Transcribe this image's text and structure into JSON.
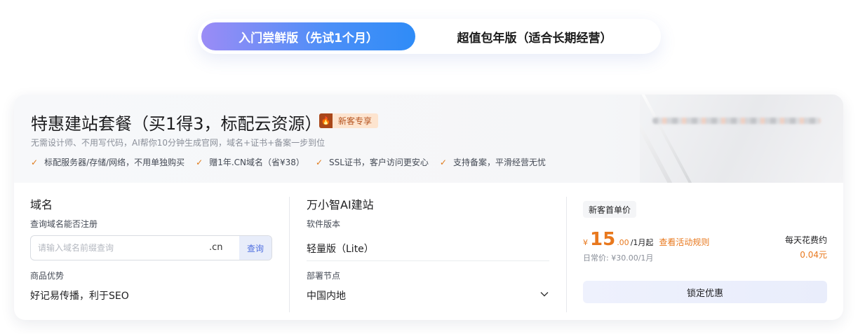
{
  "tabs": [
    {
      "label": "入门尝鲜版（先试1个月）",
      "active": true
    },
    {
      "label": "超值包年版（适合长期经营）",
      "active": false
    }
  ],
  "package": {
    "title": "特惠建站套餐（买1得3，标配云资源）",
    "badge_icon": "flame-icon",
    "badge": "新客专享",
    "subtitle": "无需设计师、不用写代码，AI帮你10分钟生成官网，域名+证书+备案一步到位",
    "features": [
      "标配服务器/存储/网络，不用单独购买",
      "赠1年.CN域名（省¥38）",
      "SSL证书，客户访问更安心",
      "支持备案，平滑经营无忧"
    ]
  },
  "domain": {
    "heading": "域名",
    "query_label": "查询域名能否注册",
    "placeholder": "请输入域名前缀查询",
    "suffix": ".cn",
    "query_button": "查询",
    "advantage_label": "商品优势",
    "advantage_value": "好记易传播，利于SEO"
  },
  "builder": {
    "heading": "万小智AI建站",
    "version_label": "软件版本",
    "version_value": "轻量版（Lite）",
    "node_label": "部署节点",
    "node_value": "中国内地"
  },
  "pricing": {
    "tag": "新客首单价",
    "currency": "¥",
    "price_int": "15",
    "price_dec": ".00",
    "unit": "/1月起",
    "rules_link": "查看活动规则",
    "original": "日常价: ¥30.00/1月",
    "daily_label": "每天花费约",
    "daily_value": "0.04元",
    "button": "锁定优惠"
  },
  "colors": {
    "accent_orange": "#e8781d",
    "tab_gradient_start": "#9b8cf6",
    "tab_gradient_end": "#2f8cf7",
    "query_blue": "#4f6fe0"
  }
}
